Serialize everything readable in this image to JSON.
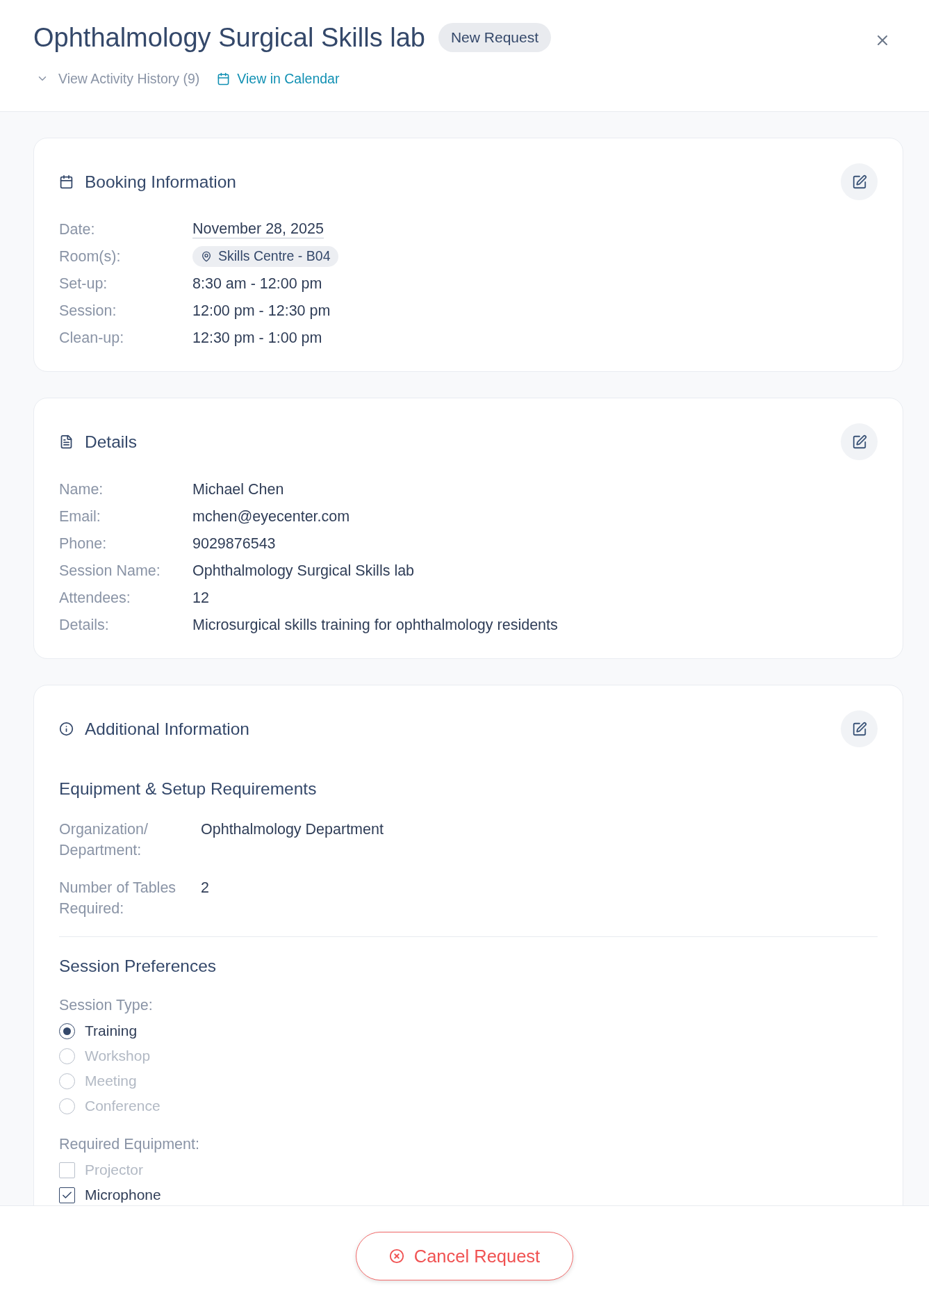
{
  "header": {
    "title": "Ophthalmology Surgical Skills lab",
    "status_badge": "New Request",
    "activity_history_link": "View Activity History (9)",
    "calendar_link": "View in Calendar"
  },
  "booking_information": {
    "title": "Booking Information",
    "fields": [
      {
        "label": "Date:",
        "value": "November 28, 2025",
        "kind": "underlined"
      },
      {
        "label": "Room(s):",
        "value": "Skills Centre - B04",
        "kind": "room_tag"
      },
      {
        "label": "Set-up:",
        "value": "8:30 am - 12:00 pm",
        "kind": "text"
      },
      {
        "label": "Session:",
        "value": "12:00 pm - 12:30 pm",
        "kind": "text"
      },
      {
        "label": "Clean-up:",
        "value": "12:30 pm - 1:00 pm",
        "kind": "text"
      }
    ]
  },
  "details": {
    "title": "Details",
    "fields": [
      {
        "label": "Name:",
        "value": "Michael Chen"
      },
      {
        "label": "Email:",
        "value": "mchen@eyecenter.com"
      },
      {
        "label": "Phone:",
        "value": "9029876543"
      },
      {
        "label": "Session Name:",
        "value": "Ophthalmology Surgical Skills lab"
      },
      {
        "label": "Attendees:",
        "value": "12"
      },
      {
        "label": "Details:",
        "value": "Microsurgical skills training for ophthalmology residents"
      }
    ]
  },
  "additional_information": {
    "title": "Additional Information",
    "sections": [
      {
        "title": "Equipment & Setup Requirements",
        "fields": [
          {
            "label": "Organization/ Department:",
            "value": "Ophthalmology Department"
          },
          {
            "label": "Number of Tables Required:",
            "value": "2"
          }
        ]
      },
      {
        "title": "Session Preferences",
        "groups": [
          {
            "label": "Session Type:",
            "kind": "radio",
            "options": [
              {
                "label": "Training",
                "selected": true
              },
              {
                "label": "Workshop",
                "selected": false
              },
              {
                "label": "Meeting",
                "selected": false
              },
              {
                "label": "Conference",
                "selected": false
              }
            ]
          },
          {
            "label": "Required Equipment:",
            "kind": "checkbox",
            "options": [
              {
                "label": "Projector",
                "checked": false
              },
              {
                "label": "Microphone",
                "checked": true
              }
            ]
          }
        ]
      }
    ]
  },
  "footer": {
    "cancel_button": "Cancel Request"
  }
}
